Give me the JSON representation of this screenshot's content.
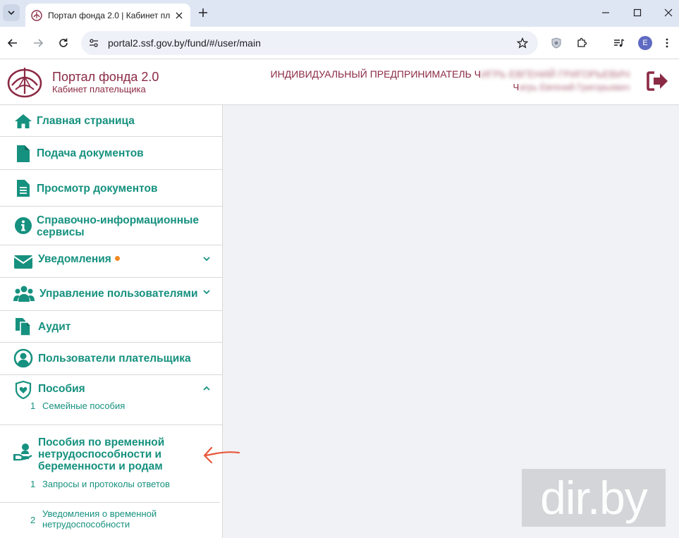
{
  "browser": {
    "tab_title": "Портал фонда 2.0 | Кабинет пл",
    "url": "portal2.ssf.gov.by/fund/#/user/main",
    "profile_letter": "E"
  },
  "header": {
    "title": "Портал фонда 2.0",
    "subtitle": "Кабинет плательщика",
    "company": "ИНДИВИДУАЛЬНЫЙ ПРЕДПРИНИМАТЕЛЬ Ч",
    "company_hidden": "ИГРЬ ЕВГЕНИЙ ГРИГОРЬЕВИЧ",
    "person": "Ч",
    "person_hidden": "игрь Евгений Григорьевич"
  },
  "sidebar": {
    "items": [
      {
        "label": "Главная страница",
        "icon": "home-icon"
      },
      {
        "label": "Подача документов",
        "icon": "document-icon"
      },
      {
        "label": "Просмотр документов",
        "icon": "document-lines-icon"
      },
      {
        "label": "Справочно-информационные сервисы",
        "icon": "info-icon"
      },
      {
        "label": "Уведомления",
        "icon": "envelope-icon",
        "badge": true
      },
      {
        "label": "Управление пользователями",
        "icon": "users-icon"
      },
      {
        "label": "Аудит",
        "icon": "copy-document-icon"
      },
      {
        "label": "Пользователи плательщика",
        "icon": "user-circle-icon"
      },
      {
        "label": "Пособия",
        "icon": "shield-heart-icon",
        "sub": [
          {
            "num": "1",
            "label": "Семейные пособия"
          }
        ]
      },
      {
        "label": "Пособия по временной нетрудоспособности и беременности и родам",
        "icon": "hand-user-icon",
        "sub": [
          {
            "num": "1",
            "label": "Запросы и протоколы ответов"
          },
          {
            "num": "2",
            "label": "Уведомления о временной нетрудоспособности"
          }
        ]
      }
    ]
  },
  "watermark": "dir.by",
  "colors": {
    "accent": "#16917f",
    "brand": "#8b2a44",
    "badge": "#f28a23",
    "arrow": "#e8593c",
    "content_bg": "#f1f2f5"
  }
}
